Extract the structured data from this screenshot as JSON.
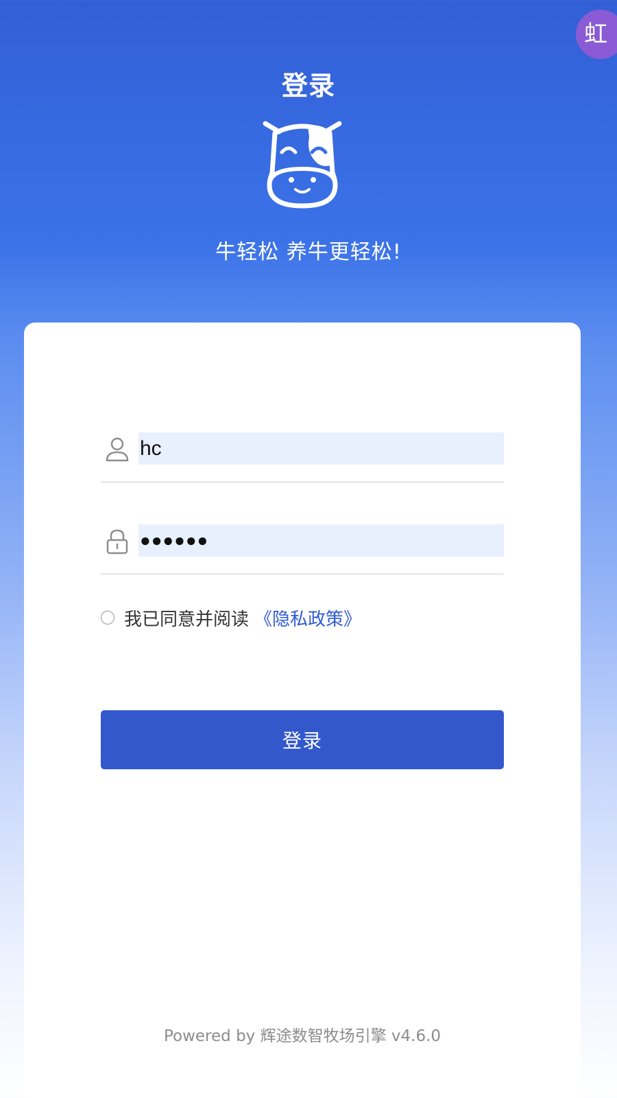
{
  "header": {
    "title": "登录",
    "slogan": "牛轻松 养牛更轻松!",
    "logo_icon": "cow-face-icon",
    "floating_button_text": "虹"
  },
  "form": {
    "username": {
      "icon": "user-icon",
      "value": "hc"
    },
    "password": {
      "icon": "lock-icon",
      "value": "●●●●●●"
    },
    "agreement": {
      "text": "我已同意并阅读",
      "link_text": "《隐私政策》",
      "checked": false
    },
    "submit_label": "登录"
  },
  "footer": {
    "text": "Powered by 辉途数智牧场引擎 v4.6.0"
  },
  "colors": {
    "primary": "#3358cc",
    "link": "#2f5bd1",
    "input_autofill_bg": "#e8f0fe",
    "header_gradient_top": "#325fd6"
  }
}
